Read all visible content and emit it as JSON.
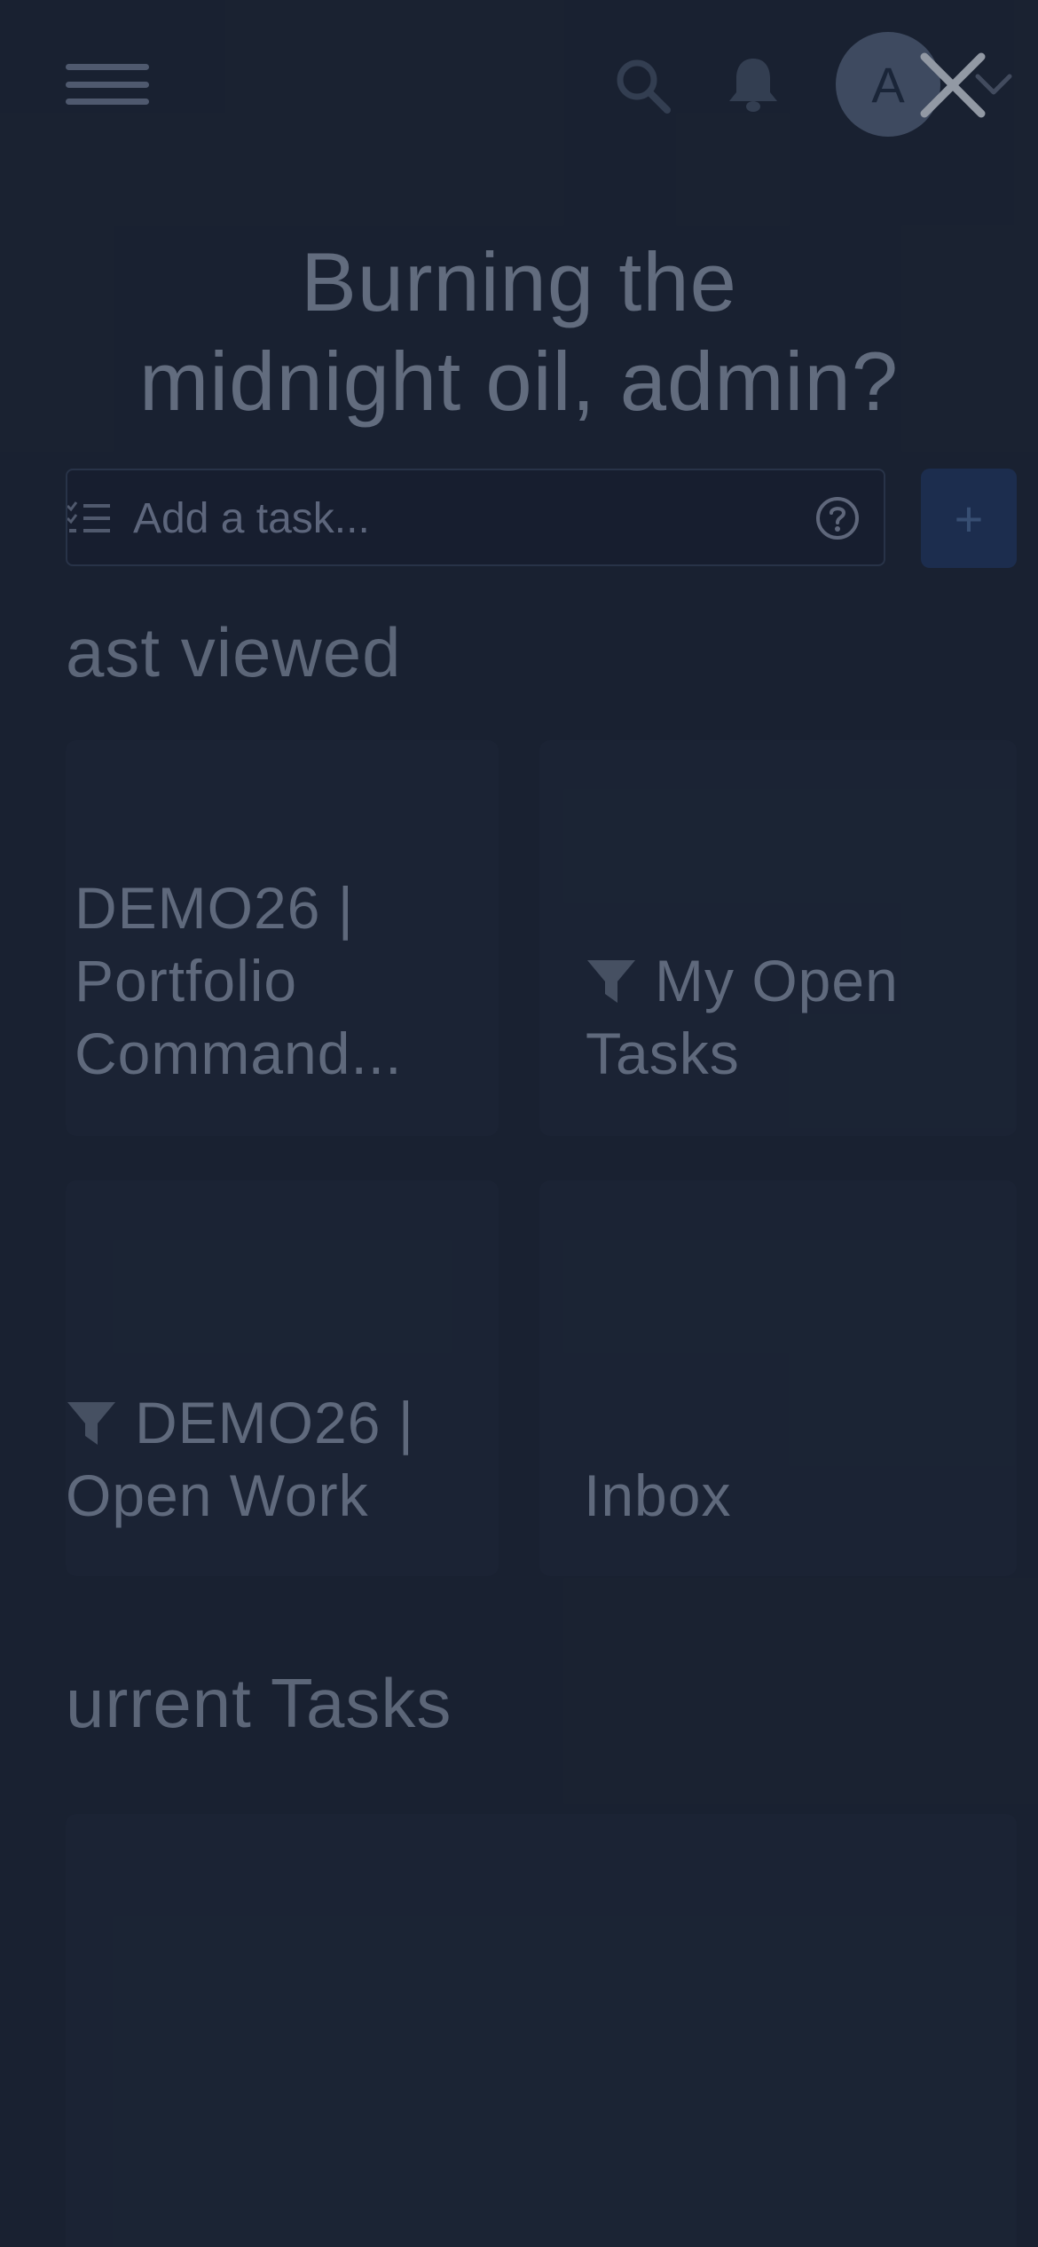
{
  "header": {
    "avatar_initial": "A"
  },
  "greeting": {
    "line1": "Burning the",
    "line2": "midnight oil, admin?"
  },
  "add_task": {
    "placeholder": "Add a task...",
    "add_label": "+"
  },
  "last_viewed": {
    "title": "ast viewed",
    "items": [
      {
        "line1": "DEMO26 |",
        "line2": "Portfolio",
        "line3": "Command..."
      },
      {
        "line1": "My Open",
        "line2": "Tasks"
      },
      {
        "line1": "DEMO26 |",
        "line2": "Open Work"
      },
      {
        "line1": "Inbox"
      }
    ]
  },
  "current_tasks": {
    "title": "urrent Tasks"
  },
  "icons": {
    "menu": "hamburger-menu-icon",
    "search": "search-icon",
    "notifications": "bell-icon",
    "close": "close-icon",
    "filter": "filter-icon",
    "help": "help-icon",
    "list": "task-list-icon"
  }
}
